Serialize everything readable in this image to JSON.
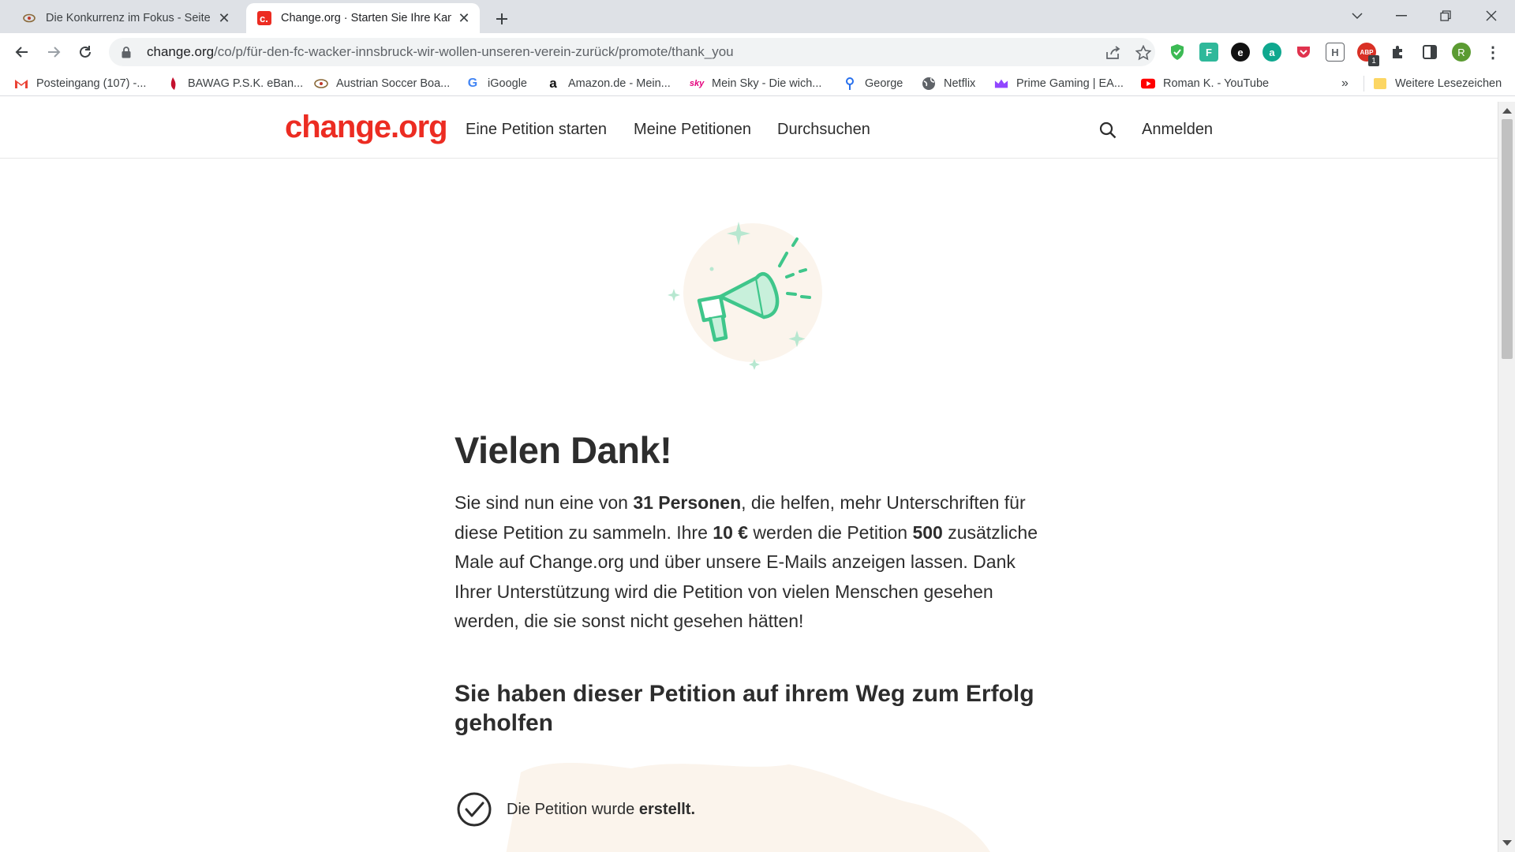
{
  "browser": {
    "tabs": [
      {
        "title": "Die Konkurrenz im Fokus - Seite",
        "active": false
      },
      {
        "title": "Change.org · Starten Sie Ihre Kam",
        "active": true
      }
    ],
    "url": {
      "host": "change.org",
      "path": "/co/p/für-den-fc-wacker-innsbruck-wir-wollen-unseren-verein-zurück/promote/thank_you"
    },
    "profile_initial": "R",
    "extension_badge": "1",
    "bookmarks": [
      {
        "label": "Posteingang (107) -...",
        "icon": "gmail-icon"
      },
      {
        "label": "BAWAG P.S.K. eBan...",
        "icon": "bawag-icon"
      },
      {
        "label": "Austrian Soccer Boa...",
        "icon": "soccer-board-icon"
      },
      {
        "label": "iGoogle",
        "icon": "google-icon"
      },
      {
        "label": "Amazon.de - Mein...",
        "icon": "amazon-icon"
      },
      {
        "label": "Mein Sky - Die wich...",
        "icon": "sky-icon"
      },
      {
        "label": "George",
        "icon": "george-icon"
      },
      {
        "label": "Netflix",
        "icon": "globe-icon"
      },
      {
        "label": "Prime Gaming | EA...",
        "icon": "prime-gaming-icon"
      },
      {
        "label": "Roman K. - YouTube",
        "icon": "youtube-icon"
      }
    ],
    "bookmarks_overflow": "»",
    "other_bookmarks": "Weitere Lesezeichen"
  },
  "site": {
    "logo": "change.org",
    "nav": [
      "Eine Petition starten",
      "Meine Petitionen",
      "Durchsuchen"
    ],
    "login": "Anmelden",
    "brand_color": "#ec2c22",
    "accent_color": "#3fc68b"
  },
  "thanks": {
    "title": "Vielen Dank!",
    "text_1": "Sie sind nun eine von ",
    "bold_people": "31 Personen",
    "text_2": ", die helfen, mehr Unterschriften für diese Petition zu sammeln. Ihre ",
    "bold_amount": "10 €",
    "text_3": " werden die Petition ",
    "bold_times": "500",
    "text_4": " zusätzliche Male auf Change.org und über unsere E-Mails anzeigen lassen. Dank Ihrer Unterstützung wird die Petition von vielen Menschen gesehen werden, die sie sonst nicht gesehen hätten!",
    "success_title": "Sie haben dieser Petition auf ihrem Weg zum Erfolg geholfen",
    "step1_text": "Die Petition wurde ",
    "step1_bold": "erstellt."
  }
}
